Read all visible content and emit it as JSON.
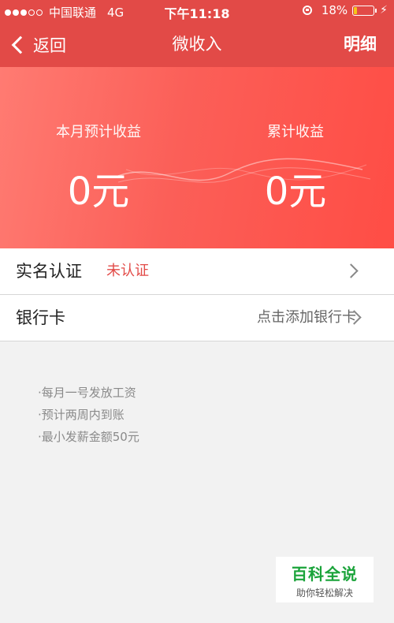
{
  "status_bar": {
    "carrier": "中国联通",
    "network": "4G",
    "time": "下午11:18",
    "battery": "18%",
    "battery_level": 0.18,
    "signal_bars_filled": 3,
    "signal_bars_total": 5
  },
  "nav": {
    "back_label": "返回",
    "title": "微收入",
    "detail_label": "明细"
  },
  "earnings": {
    "month_label": "本月预计收益",
    "month_value": "0元",
    "total_label": "累计收益",
    "total_value": "0元"
  },
  "rows": [
    {
      "title": "实名认证",
      "status": "未认证"
    },
    {
      "title": "银行卡",
      "action": "点击添加银行卡"
    }
  ],
  "notes": [
    "·每月一号发放工资",
    "·预计两周内到账",
    "·最小发薪金额50元"
  ],
  "watermark": {
    "title": "百科全说",
    "subtitle": "助你轻松解决"
  },
  "colors": {
    "primary": "#e24a47",
    "banner_start": "#ff7b72",
    "banner_end": "#ff4d45",
    "status_red": "#e24a47",
    "battery_yellow": "#f5c518",
    "watermark_green": "#1aa33a"
  }
}
